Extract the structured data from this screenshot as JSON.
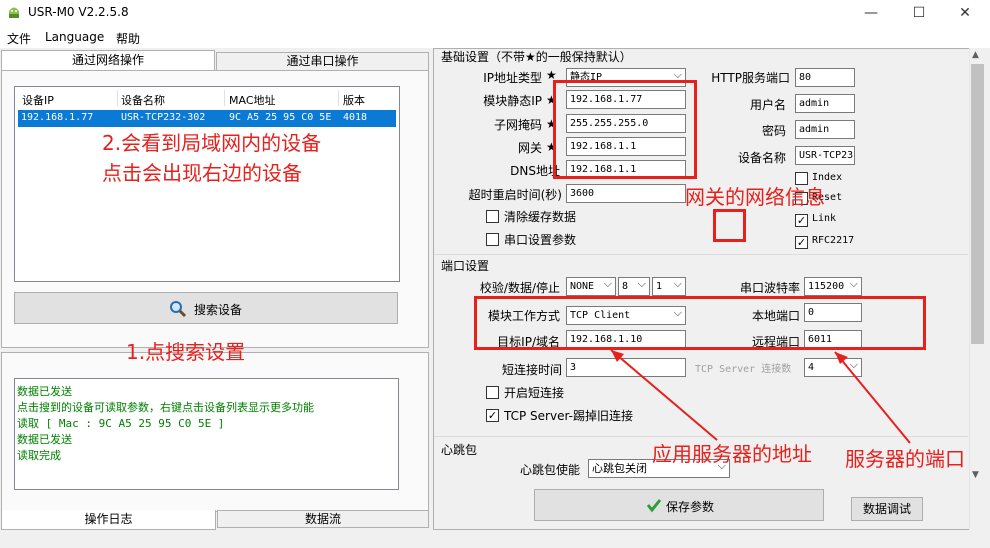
{
  "window": {
    "title": "USR-M0 V2.2.5.8",
    "minimize": "—",
    "maximize": "☐",
    "close": "✕"
  },
  "menu": [
    "文件",
    "Language",
    "帮助"
  ],
  "left_tabs": [
    "通过网络操作",
    "通过串口操作"
  ],
  "device_table": {
    "columns": [
      "设备IP",
      "设备名称",
      "MAC地址",
      "版本"
    ],
    "rows": [
      [
        "192.168.1.77",
        "USR-TCP232-302",
        "9C A5 25 95 C0 5E",
        "4018"
      ]
    ]
  },
  "search_button": "搜索设备",
  "log_lines": [
    "数据已发送",
    "点击搜到的设备可读取参数，右键点击设备列表显示更多功能",
    "读取 [ Mac : 9C A5 25 95 C0 5E ]",
    "数据已发送",
    "读取完成"
  ],
  "bottom_tabs": [
    "操作日志",
    "数据流"
  ],
  "basic": {
    "section_title": "基础设置（不带★的一般保持默认）",
    "ip_type_label": "IP地址类型",
    "ip_type_value": "静态IP",
    "static_ip_label": "模块静态IP",
    "static_ip_value": "192.168.1.77",
    "subnet_label": "子网掩码",
    "subnet_value": "255.255.255.0",
    "gateway_label": "网关",
    "gateway_value": "192.168.1.1",
    "dns_label": "DNS地址",
    "dns_value": "192.168.1.1",
    "reboot_label": "超时重启时间(秒)",
    "reboot_value": "3600",
    "clear_cache_label": "清除缓存数据",
    "serial_param_label": "串口设置参数",
    "http_port_label": "HTTP服务端口",
    "http_port_value": "80",
    "username_label": "用户名",
    "username_value": "admin",
    "password_label": "密码",
    "password_value": "admin",
    "device_name_label": "设备名称",
    "device_name_value": "USR-TCP23",
    "index_label": "Index",
    "reset_label": "Reset",
    "link_label": "Link",
    "rfc_label": "RFC2217",
    "star": "★"
  },
  "port": {
    "section_title": "端口设置",
    "verify_label": "校验/数据/停止",
    "parity": "NONE",
    "databits": "8",
    "stopbits": "1",
    "baud_label": "串口波特率",
    "baud_value": "115200",
    "mode_label": "模块工作方式",
    "mode_value": "TCP Client",
    "local_port_label": "本地端口",
    "local_port_value": "0",
    "target_label": "目标IP/域名",
    "target_value": "192.168.1.10",
    "remote_port_label": "远程端口",
    "remote_port_value": "6011",
    "short_conn_label": "短连接时间",
    "short_conn_value": "3",
    "tcp_server_conn_label": "TCP Server 连接数",
    "tcp_server_conn_value": "4",
    "open_short_label": "开启短连接",
    "kick_label": "TCP Server-踢掉旧连接"
  },
  "heartbeat": {
    "section_title": "心跳包",
    "enable_label": "心跳包使能",
    "enable_value": "心跳包关闭"
  },
  "save_button": "保存参数",
  "debug_button": "数据调试",
  "annotations": {
    "a1": "1.点搜索设置",
    "a2_line1": "2.会看到局域网内的设备",
    "a2_line2": "点击会出现右边的设备",
    "gateway_note": "网关的网络信息",
    "server_addr": "应用服务器的地址",
    "server_port": "服务器的端口"
  },
  "colors": {
    "annotation_red": "#e8201c",
    "selection_blue": "#0a7ad4",
    "log_green": "#008000"
  }
}
